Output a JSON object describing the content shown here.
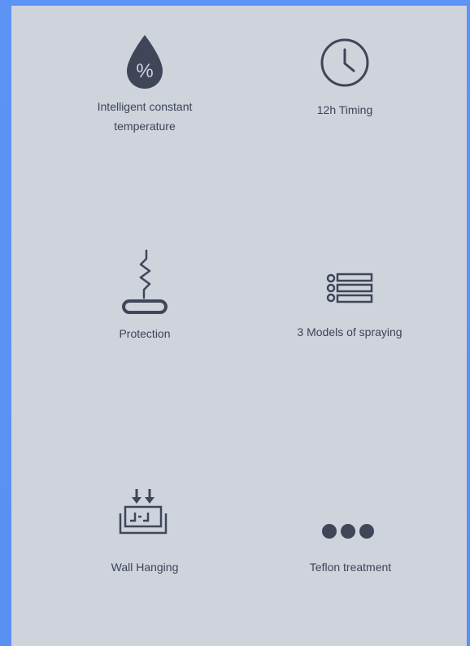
{
  "features": [
    {
      "label": "Intelligent constant temperature",
      "icon": "percent-drop-icon"
    },
    {
      "label": "12h Timing",
      "icon": "clock-icon"
    },
    {
      "label": "Protection",
      "icon": "heating-element-icon"
    },
    {
      "label": "3 Models of spraying",
      "icon": "list-icon"
    },
    {
      "label": "Wall Hanging",
      "icon": "wall-mount-icon"
    },
    {
      "label": "Teflon treatment",
      "icon": "three-dots-icon"
    }
  ],
  "colors": {
    "frame": "#5c93f4",
    "panel": "#ced3dc",
    "ink": "#3f4658"
  }
}
